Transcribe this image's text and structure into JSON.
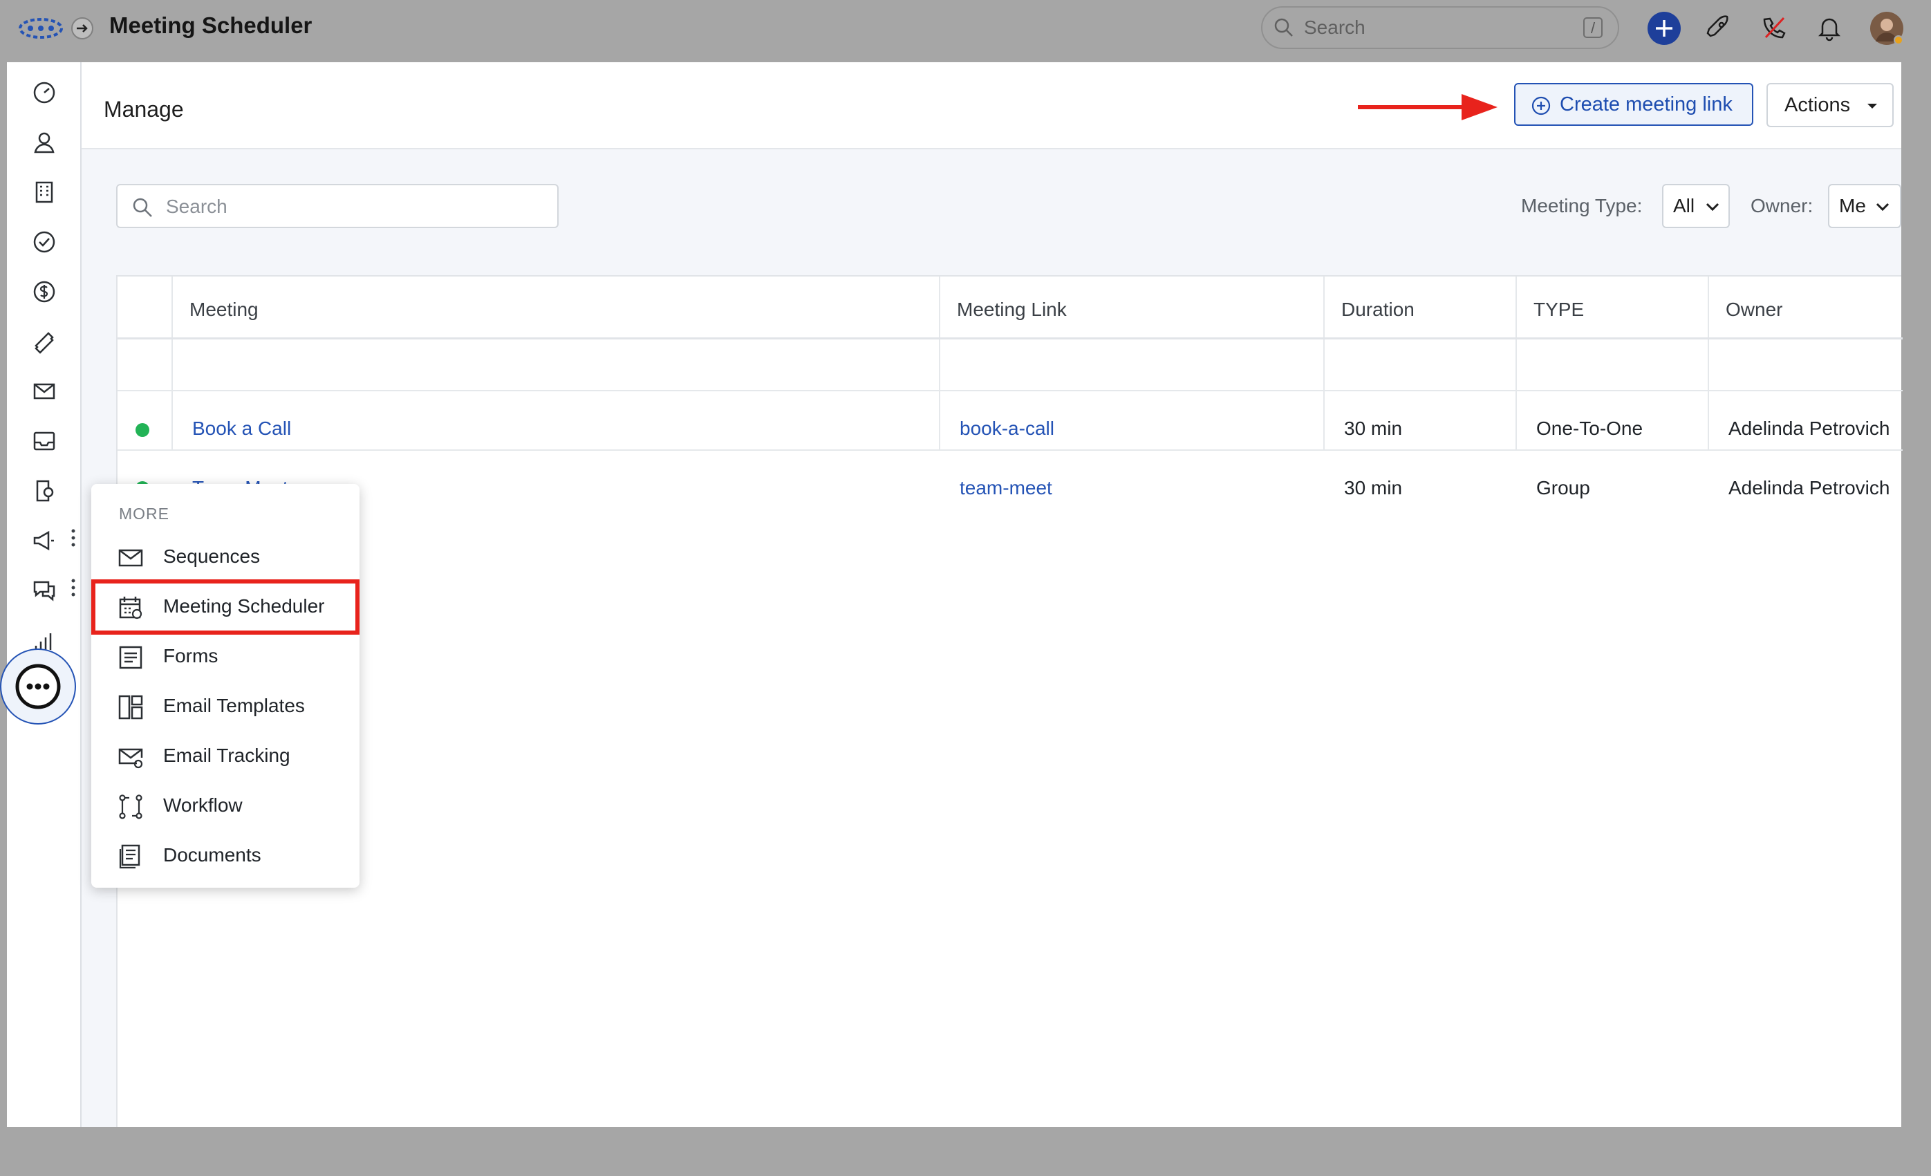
{
  "app": {
    "title": "Meeting Scheduler"
  },
  "topbar": {
    "search_placeholder": "Search",
    "search_shortcut": "/"
  },
  "header": {
    "title": "Manage",
    "create_button": "Create meeting link",
    "actions_button": "Actions"
  },
  "filters": {
    "search_placeholder": "Search",
    "meeting_type_label": "Meeting Type:",
    "meeting_type_value": "All",
    "owner_label": "Owner:",
    "owner_value": "Me"
  },
  "table": {
    "columns": [
      "Meeting",
      "Meeting Link",
      "Duration",
      "TYPE",
      "Owner"
    ],
    "rows": [
      {
        "meeting": "Book a Call",
        "link": "book-a-call",
        "duration": "30 min",
        "type": "One-To-One",
        "owner": "Adelinda Petrovich"
      },
      {
        "meeting": "Team Meet",
        "link": "team-meet",
        "duration": "30 min",
        "type": "Group",
        "owner": "Adelinda Petrovich"
      }
    ]
  },
  "more_menu": {
    "title": "MORE",
    "items": [
      {
        "label": "Sequences",
        "icon": "mail-icon"
      },
      {
        "label": "Meeting Scheduler",
        "icon": "calendar-icon"
      },
      {
        "label": "Forms",
        "icon": "form-icon"
      },
      {
        "label": "Email Templates",
        "icon": "template-icon"
      },
      {
        "label": "Email Tracking",
        "icon": "email-tracking-icon"
      },
      {
        "label": "Workflow",
        "icon": "workflow-icon"
      },
      {
        "label": "Documents",
        "icon": "document-icon"
      }
    ]
  },
  "colors": {
    "accent": "#2453b5",
    "status_active": "#22b356",
    "annotation": "#e8231c"
  }
}
